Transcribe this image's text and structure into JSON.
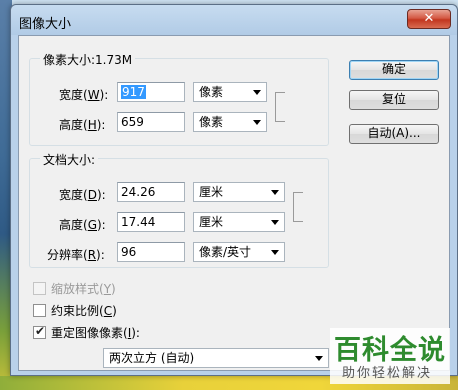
{
  "window": {
    "title": "图像大小",
    "close_symbol": "✕"
  },
  "pixel_dimensions": {
    "legend": "像素大小:1.73M",
    "width": {
      "label": "宽度(",
      "key": "W",
      "end": "):",
      "value": "917",
      "unit": "像素"
    },
    "height": {
      "label": "高度(",
      "key": "H",
      "end": "):",
      "value": "659",
      "unit": "像素"
    }
  },
  "document_size": {
    "legend": "文档大小:",
    "width": {
      "label": "宽度(",
      "key": "D",
      "end": "):",
      "value": "24.26",
      "unit": "厘米"
    },
    "height": {
      "label": "高度(",
      "key": "G",
      "end": "):",
      "value": "17.44",
      "unit": "厘米"
    },
    "resolution": {
      "label": "分辨率(",
      "key": "R",
      "end": "):",
      "value": "96",
      "unit": "像素/英寸"
    }
  },
  "buttons": {
    "ok": "确定",
    "reset": "复位",
    "auto": "自动(A)..."
  },
  "options": {
    "scale_styles": {
      "label": "缩放样式(",
      "key": "Y",
      "end": ")",
      "checked": false,
      "enabled": false
    },
    "constrain": {
      "label": "约束比例(",
      "key": "C",
      "end": ")",
      "checked": false,
      "enabled": true
    },
    "resample": {
      "label": "重定图像像素(",
      "key": "I",
      "end": "):",
      "checked": true,
      "enabled": true
    },
    "resample_method": "两次立方 (自动)"
  },
  "watermark": {
    "main": "百科全说",
    "sub": "助你轻松解决"
  }
}
